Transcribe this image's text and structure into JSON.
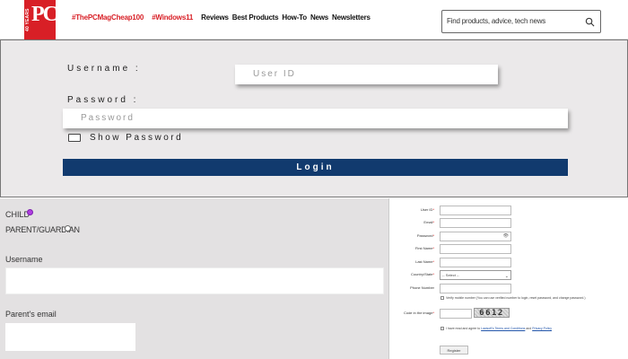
{
  "header": {
    "logo_text": "PC",
    "logo_years": "40 YEARS",
    "nav": [
      "#ThePCMagCheap100",
      "#Windows11",
      "Reviews",
      "Best Products",
      "How-To",
      "News",
      "Newsletters"
    ],
    "search_placeholder": "Find products, advice, tech news"
  },
  "login": {
    "username_label": "Username :",
    "username_placeholder": "User ID",
    "password_label": "Password :",
    "password_placeholder": "Password",
    "show_password_label": "Show Password",
    "login_button": "Login"
  },
  "signup": {
    "child_label": "CHILD",
    "parent_label": "PARENT/GUARDIAN",
    "username_label": "Username",
    "parent_email_label": "Parent's email"
  },
  "register": {
    "fields": [
      "User ID",
      "Email",
      "Password",
      "First Name",
      "Last Name",
      "Country/State",
      "Phone Number"
    ],
    "country_select": "-- Select --",
    "verify_text": "Verify mobile number (You can use verified number to login, reset password, and change password.)",
    "captcha_label": "Code in the image",
    "captcha_code": "6612",
    "agree_text_prefix": "I have read and agree to",
    "terms_link": "Lawsoft's Terms and Conditions",
    "and_text": "and",
    "privacy_link": "Privacy Policy",
    "register_button": "Register"
  },
  "colors": {
    "brand_red": "#d81f26",
    "login_navy": "#113a6e",
    "radio_purple": "#b03ee0"
  }
}
